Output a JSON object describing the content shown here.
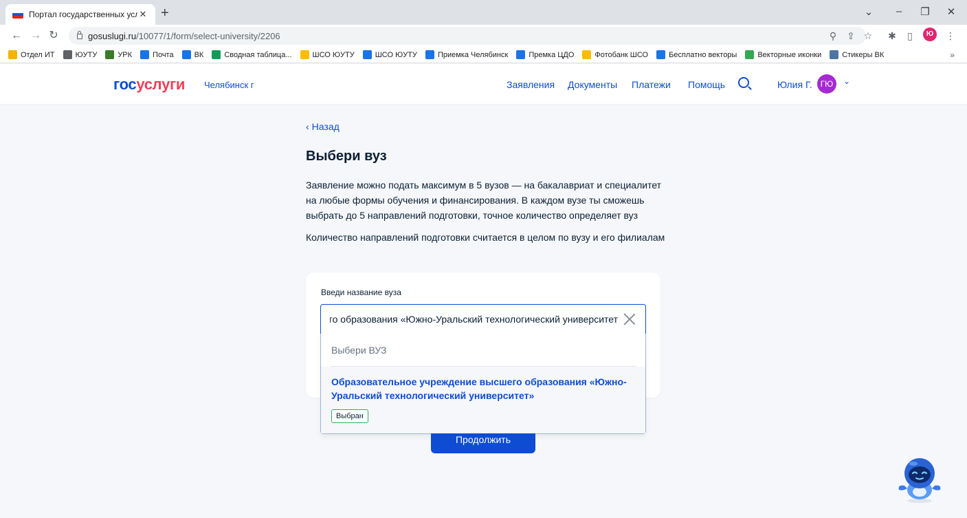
{
  "browser": {
    "tab_title": "Портал государственных услуг",
    "tab_close": "✕",
    "new_tab": "+",
    "url_host": "gosuslugi.ru",
    "url_path": "/10077/1/form/select-university/2206",
    "profile_initial": "Ю",
    "bookmarks": [
      {
        "label": "Отдел ИТ",
        "icon": "folder-icon",
        "color": "#f4b400"
      },
      {
        "label": "ЮУТУ",
        "icon": "university-icon",
        "color": "#5f6368"
      },
      {
        "label": "УРК",
        "icon": "leaf-icon",
        "color": "#3b7a2a"
      },
      {
        "label": "Почта",
        "icon": "mail-icon",
        "color": "#1a73e8"
      },
      {
        "label": "ВК",
        "icon": "vk-icon",
        "color": "#1a73e8"
      },
      {
        "label": "Сводная таблица...",
        "icon": "sheets-icon",
        "color": "#0f9d58"
      },
      {
        "label": "ШСО ЮУТУ",
        "icon": "drive-icon",
        "color": "#fbbc04"
      },
      {
        "label": "ШСО ЮУТУ",
        "icon": "cloud-icon",
        "color": "#1a73e8"
      },
      {
        "label": "Приемка Челябинск",
        "icon": "cloud-icon",
        "color": "#1a73e8"
      },
      {
        "label": "Премка ЦДО",
        "icon": "cloud-icon",
        "color": "#1a73e8"
      },
      {
        "label": "Фотобанк ШСО",
        "icon": "drive-icon",
        "color": "#fbbc04"
      },
      {
        "label": "Бесплатно векторы",
        "icon": "vector-icon",
        "color": "#1a73e8"
      },
      {
        "label": "Векторные иконки",
        "icon": "v-icon",
        "color": "#34a853"
      },
      {
        "label": "Стикеры ВК",
        "icon": "vk-sticker-icon",
        "color": "#4c75a3"
      }
    ],
    "bookmarks_more": "»"
  },
  "header": {
    "logo_part1": "гос",
    "logo_part2": "услуги",
    "city": "Челябинск г",
    "nav": [
      "Заявления",
      "Документы",
      "Платежи",
      "Помощь"
    ],
    "user_name": "Юлия Г.",
    "user_initials": "ГЮ",
    "colors": {
      "brand_blue": "#0d4cd3",
      "brand_red": "#ee3f58",
      "avatar": "#a52ad1"
    }
  },
  "main": {
    "back_label": "Назад",
    "title": "Выбери вуз",
    "description": "Заявление можно подать максимум в 5 вузов — на бакалавриат и специалитет на любые формы обучения и финансирования. В каждом вузе ты сможешь выбрать до 5 направлений подготовки, точное количество определяет вуз",
    "note": "Количество направлений подготовки считается в целом по вузу и его филиалам",
    "field_label": "Введи название вуза",
    "field_value": "Образовательное учреждение высшего образования «Южно-Уральский технологический университет»",
    "dropdown_header": "Выбери ВУЗ",
    "option_label": "Образовательное учреждение высшего образования «Южно-Уральский технологический университет»",
    "option_badge": "Выбран",
    "continue_label": "Продолжить"
  }
}
